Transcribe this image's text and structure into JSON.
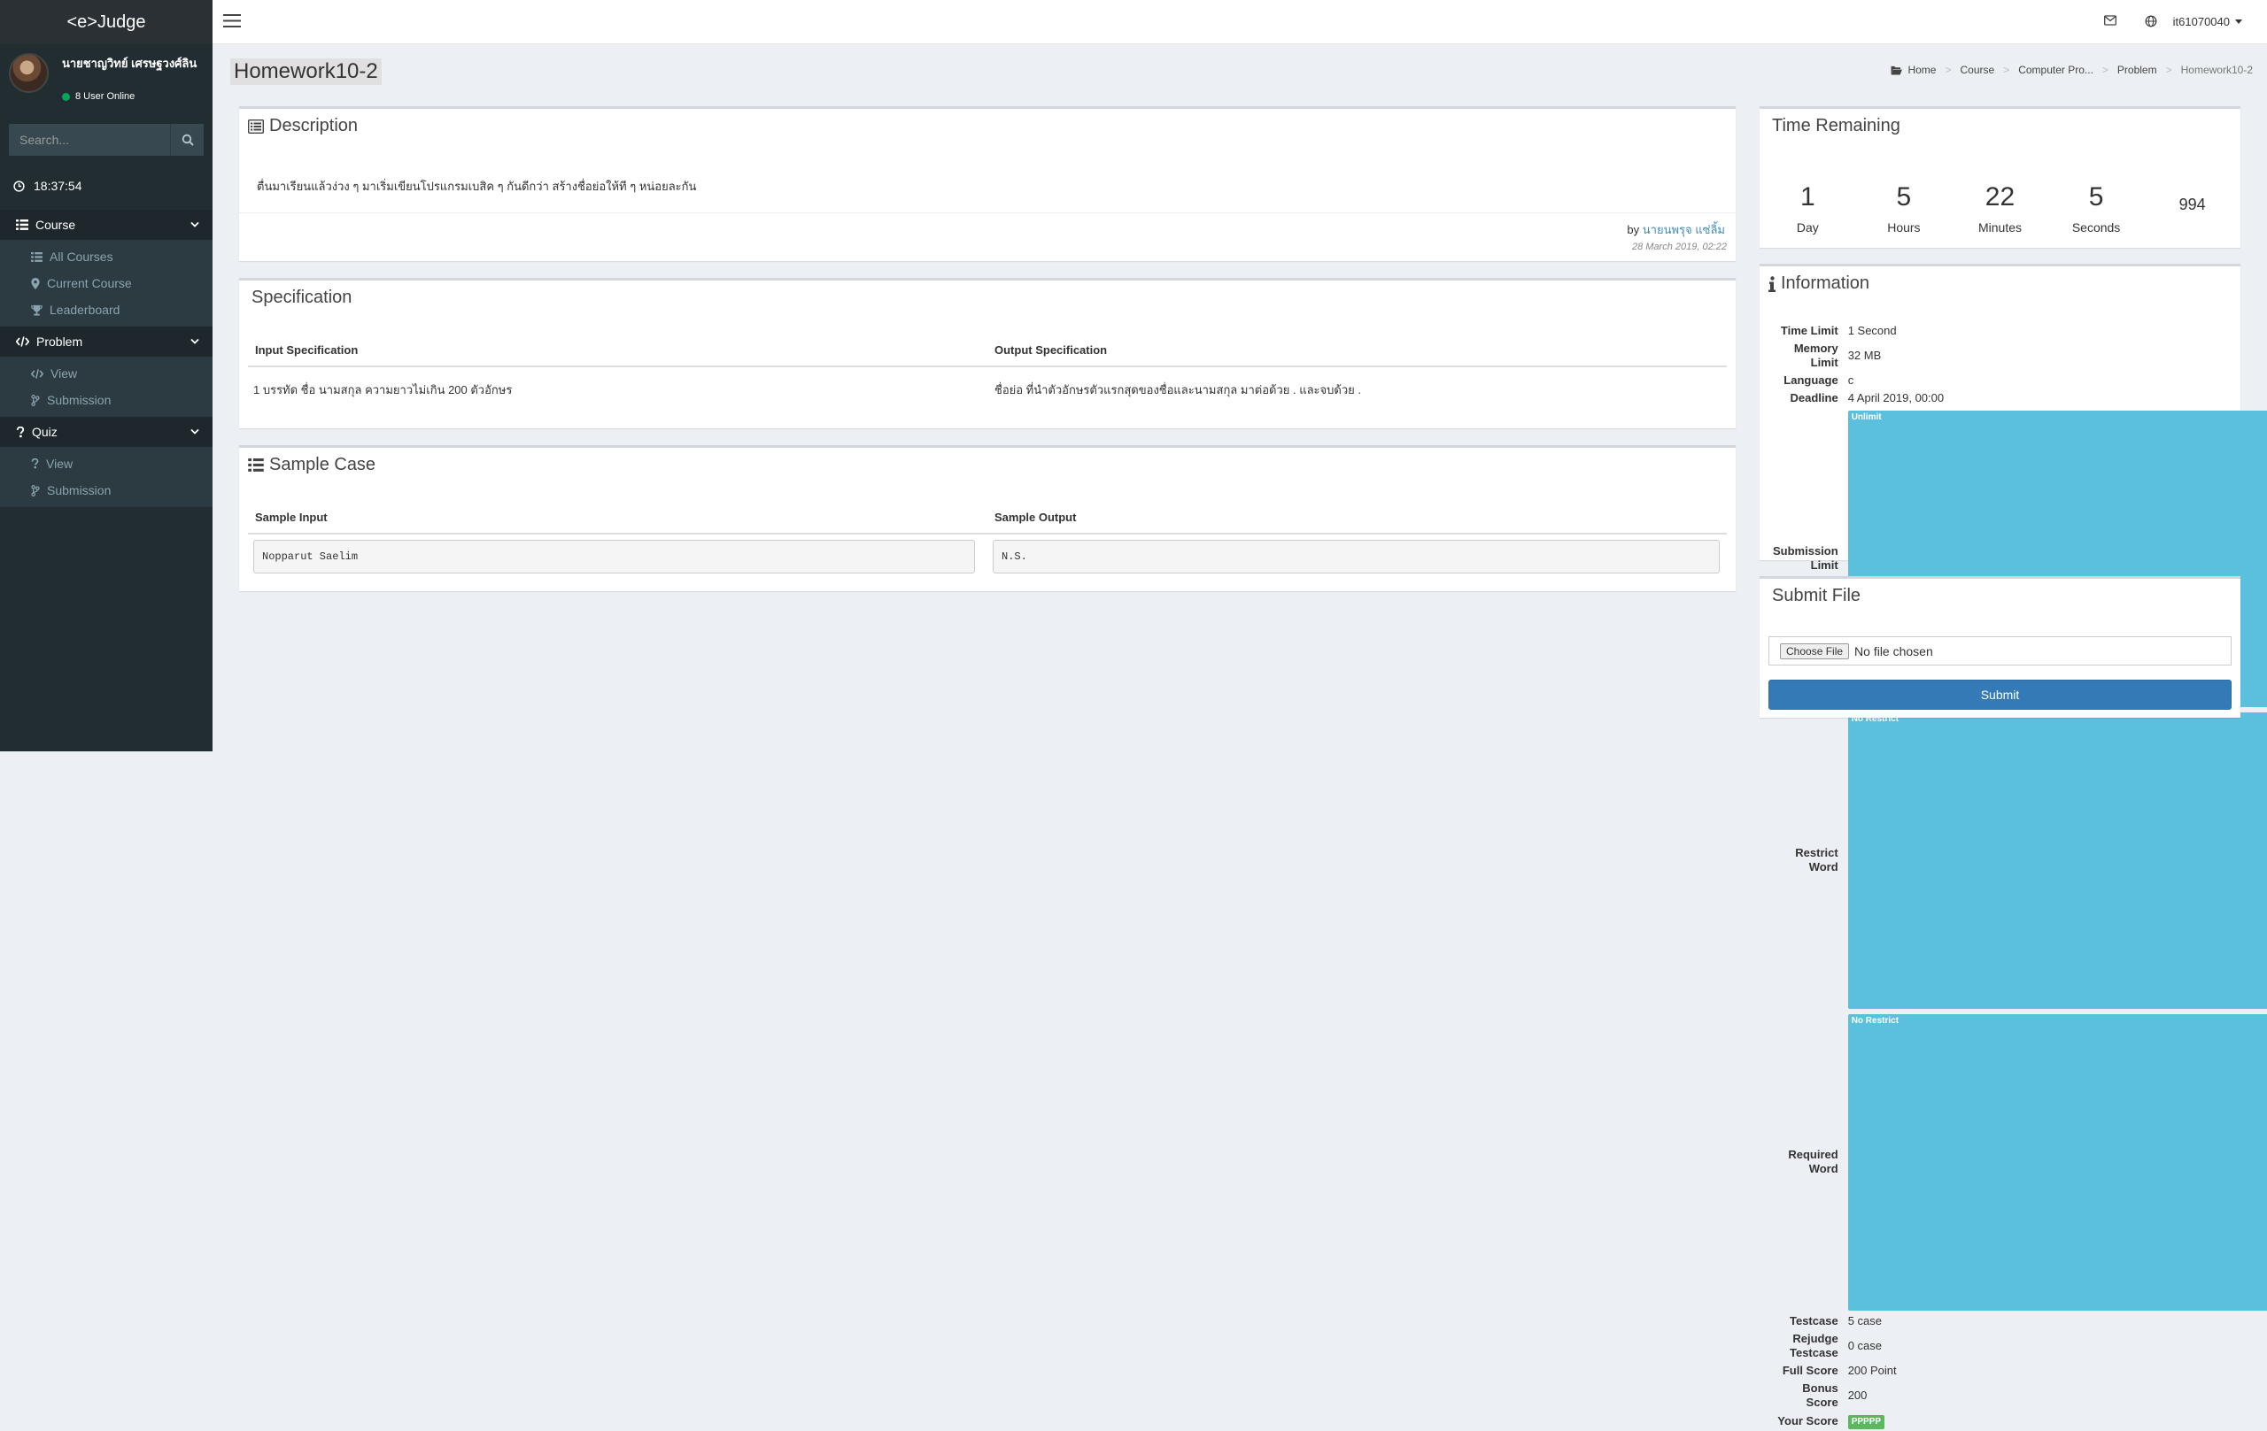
{
  "app": {
    "logo": "<e>Judge"
  },
  "user": {
    "name": "นายชาญวิทย์ เศรษฐวงศ์ลิน",
    "online": "8 User Online"
  },
  "sidebar": {
    "search_placeholder": "Search...",
    "clock": "18:37:54",
    "sections": [
      {
        "label": "Course",
        "items": [
          "All Courses",
          "Current Course",
          "Leaderboard"
        ]
      },
      {
        "label": "Problem",
        "items": [
          "View",
          "Submission"
        ]
      },
      {
        "label": "Quiz",
        "items": [
          "View",
          "Submission"
        ]
      }
    ]
  },
  "topbar": {
    "username": "it61070040"
  },
  "page": {
    "title": "Homework10-2"
  },
  "breadcrumb": [
    "Home",
    "Course",
    "Computer Pro...",
    "Problem",
    "Homework10-2"
  ],
  "description": {
    "heading": "Description",
    "text": "ตื่นมาเรียนแล้วง่วง ๆ มาเริ่มเขียนโปรแกรมเบสิค ๆ กันดีกว่า สร้างชื่อย่อให้ที ๆ หน่อยละกัน",
    "by_label": "by",
    "author": "นายนพรุจ แซ่ลิ้ม",
    "date": "28 March 2019, 02:22"
  },
  "specification": {
    "heading": "Specification",
    "input_header": "Input Specification",
    "output_header": "Output Specification",
    "input_text": "1 บรรทัด ชื่อ นามสกุล ความยาวไม่เกิน 200 ตัวอักษร",
    "output_text": "ชื่อย่อ ที่นำตัวอักษรตัวแรกสุดของชื่อและนามสกุล มาต่อด้วย . และจบด้วย ."
  },
  "sample": {
    "heading": "Sample Case",
    "input_header": "Sample Input",
    "output_header": "Sample Output",
    "input": "Nopparut Saelim",
    "output": "N.S."
  },
  "time_remaining": {
    "heading": "Time Remaining",
    "units": [
      {
        "value": "1",
        "label": "Day"
      },
      {
        "value": "5",
        "label": "Hours"
      },
      {
        "value": "22",
        "label": "Minutes"
      },
      {
        "value": "5",
        "label": "Seconds"
      },
      {
        "value": "994",
        "label": ""
      }
    ]
  },
  "information": {
    "heading": "Information",
    "rows": [
      {
        "key": "Time Limit",
        "value": "1 Second",
        "badge": ""
      },
      {
        "key": "Memory Limit",
        "value": "32 MB",
        "badge": ""
      },
      {
        "key": "Language",
        "value": "c",
        "badge": ""
      },
      {
        "key": "Deadline",
        "value": "4 April 2019, 00:00",
        "badge": ""
      },
      {
        "key": "Submission Limit",
        "value": "Unlimit",
        "badge": "info"
      },
      {
        "key": "Restrict Word",
        "value": "No Restrict",
        "badge": "info"
      },
      {
        "key": "Required Word",
        "value": "No Restrict",
        "badge": "info"
      },
      {
        "key": "Testcase",
        "value": "5 case",
        "badge": ""
      },
      {
        "key": "Rejudge Testcase",
        "value": "0 case",
        "badge": ""
      },
      {
        "key": "Full Score",
        "value": "200 Point",
        "badge": ""
      },
      {
        "key": "Bonus Score",
        "value": "200",
        "badge": ""
      },
      {
        "key": "Your Score",
        "value": "PPPPP",
        "badge": "ok"
      }
    ]
  },
  "submit": {
    "heading": "Submit File",
    "choose": "Choose File",
    "no_file": "No file chosen",
    "button": "Submit"
  },
  "colors": {
    "sidebar": "#222d32",
    "primary": "#337ab7",
    "link": "#3c8dbc",
    "badge_info": "#5bc0de",
    "badge_ok": "#5cb85c"
  }
}
